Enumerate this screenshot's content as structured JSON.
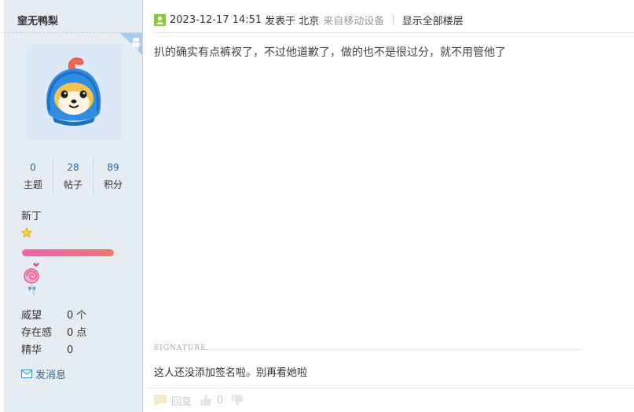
{
  "user": {
    "name": "窐无鸭梨",
    "stats": [
      {
        "value": "0",
        "label": "主题"
      },
      {
        "value": "28",
        "label": "帖子"
      },
      {
        "value": "89",
        "label": "积分"
      }
    ],
    "rank": "新丁",
    "progress_fraction": 0.9,
    "fields": [
      {
        "key": "威望",
        "value": "0",
        "unit": "个"
      },
      {
        "key": "存在感",
        "value": "0",
        "unit": "点"
      },
      {
        "key": "精华",
        "value": "0",
        "unit": ""
      }
    ],
    "send_message": "发消息"
  },
  "post": {
    "time": "2023-12-17 14:51",
    "location": "发表于 北京",
    "device": "来自移动设备",
    "separator": "|",
    "show_all": "显示全部楼层",
    "content": "扒的确实有点裤衩了，不过他道歉了，做的也不是很过分，就不用管他了"
  },
  "signature": {
    "label": "SIGNATURE",
    "text": "这人还没添加签名啦。别再看她啦"
  },
  "footer": {
    "reply_label": "回复",
    "like_count": "0"
  },
  "colors": {
    "sidebar_bg": "#e5edf2",
    "link": "#336699",
    "progress": "#ef6d8b"
  },
  "icons": [
    "android-icon",
    "avatar",
    "star-icon",
    "lollipop-icon",
    "envelope-icon",
    "online-status-icon",
    "reply-icon",
    "thumbs-up-icon",
    "thumbs-down-icon"
  ]
}
